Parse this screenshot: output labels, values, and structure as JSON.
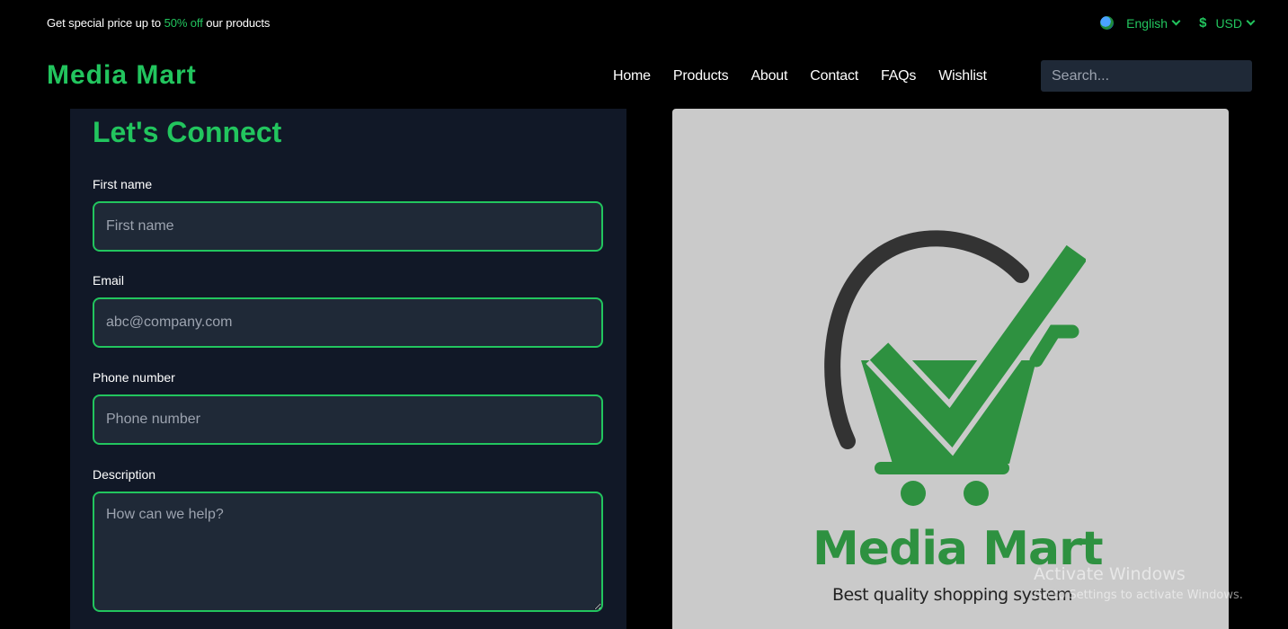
{
  "promo": {
    "prefix": "Get special price up to ",
    "highlight": "50% off",
    "suffix": " our products"
  },
  "locale": {
    "language": "English",
    "currency_symbol": "$",
    "currency": "USD"
  },
  "header": {
    "brand": "Media Mart",
    "nav": [
      "Home",
      "Products",
      "About",
      "Contact",
      "FAQs",
      "Wishlist"
    ],
    "search_placeholder": "Search..."
  },
  "contact": {
    "title": "Let's Connect",
    "first_name_label": "First name",
    "first_name_placeholder": "First name",
    "email_label": "Email",
    "email_placeholder": "abc@company.com",
    "phone_label": "Phone number",
    "phone_placeholder": "Phone number",
    "description_label": "Description",
    "description_placeholder": "How can we help?"
  },
  "logo": {
    "title": "Media Mart",
    "tagline": "Best quality shopping system"
  },
  "watermark": {
    "line1": "Activate Windows",
    "line2": "Go to Settings to activate Windows."
  },
  "colors": {
    "accent": "#22c55e",
    "panel_bg": "#111827",
    "input_bg": "#1f2937",
    "logo_green": "#2e9140",
    "card_bg": "#cacaca"
  }
}
